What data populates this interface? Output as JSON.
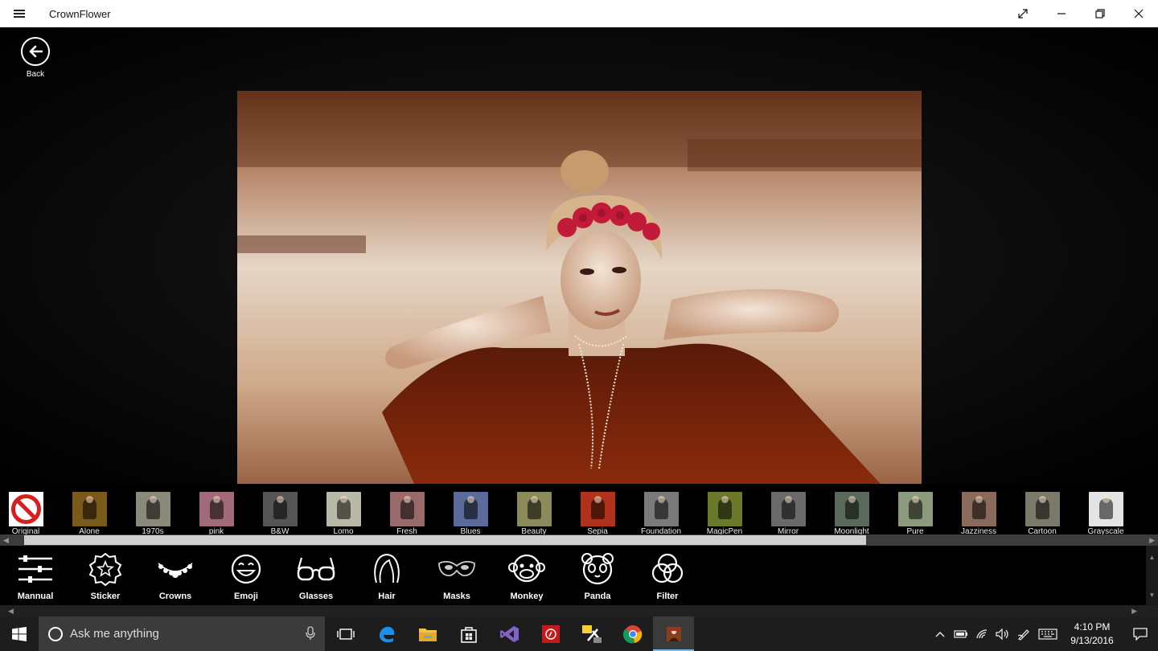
{
  "window": {
    "title": "CrownFlower",
    "menu_icon": "hamburger-icon",
    "controls": [
      "expand-icon",
      "minimize-icon",
      "restore-icon",
      "close-icon"
    ]
  },
  "back": {
    "label": "Back",
    "icon": "back-arrow-icon"
  },
  "filters": [
    {
      "label": "Original",
      "tint": "#ffffff"
    },
    {
      "label": "Alone",
      "tint": "#7a5a1a"
    },
    {
      "label": "1970s",
      "tint": "#8a8a7a"
    },
    {
      "label": "pink",
      "tint": "#a06a7a"
    },
    {
      "label": "B&W",
      "tint": "#555555"
    },
    {
      "label": "Lomo",
      "tint": "#b9b9a8"
    },
    {
      "label": "Fresh",
      "tint": "#9a6a6a"
    },
    {
      "label": "Blues",
      "tint": "#5a6a9a"
    },
    {
      "label": "Beauty",
      "tint": "#8a8a5a"
    },
    {
      "label": "Sepia",
      "tint": "#b0321a"
    },
    {
      "label": "Foundation",
      "tint": "#7a7a7a"
    },
    {
      "label": "MagicPen",
      "tint": "#6a7a2a"
    },
    {
      "label": "Mirror",
      "tint": "#6a6a6a"
    },
    {
      "label": "Moonlight",
      "tint": "#5a6a5a"
    },
    {
      "label": "Pure",
      "tint": "#8a9a7a"
    },
    {
      "label": "Jazziness",
      "tint": "#8a6a5a"
    },
    {
      "label": "Cartoon",
      "tint": "#7a7a6a"
    },
    {
      "label": "Grayscale",
      "tint": "#e4e4e4"
    }
  ],
  "tools": [
    {
      "label": "Mannual",
      "icon": "sliders-icon"
    },
    {
      "label": "Sticker",
      "icon": "sticker-star-icon"
    },
    {
      "label": "Crowns",
      "icon": "crown-necklace-icon"
    },
    {
      "label": "Emoji",
      "icon": "emoji-face-icon"
    },
    {
      "label": "Glasses",
      "icon": "glasses-icon"
    },
    {
      "label": "Hair",
      "icon": "hair-icon"
    },
    {
      "label": "Masks",
      "icon": "mask-icon"
    },
    {
      "label": "Monkey",
      "icon": "monkey-icon"
    },
    {
      "label": "Panda",
      "icon": "panda-icon"
    },
    {
      "label": "Filter",
      "icon": "filter-circles-icon"
    }
  ],
  "taskbar": {
    "search_placeholder": "Ask me anything",
    "apps": [
      "task-view-icon",
      "edge-icon",
      "file-explorer-icon",
      "store-icon",
      "visual-studio-icon",
      "red-app-icon",
      "tools-app-icon",
      "chrome-icon",
      "crownflower-app-icon"
    ],
    "time": "4:10 PM",
    "date": "9/13/2016"
  },
  "colors": {
    "accent": "#76b9ed",
    "sepia_photo": "#8a3d1a"
  }
}
